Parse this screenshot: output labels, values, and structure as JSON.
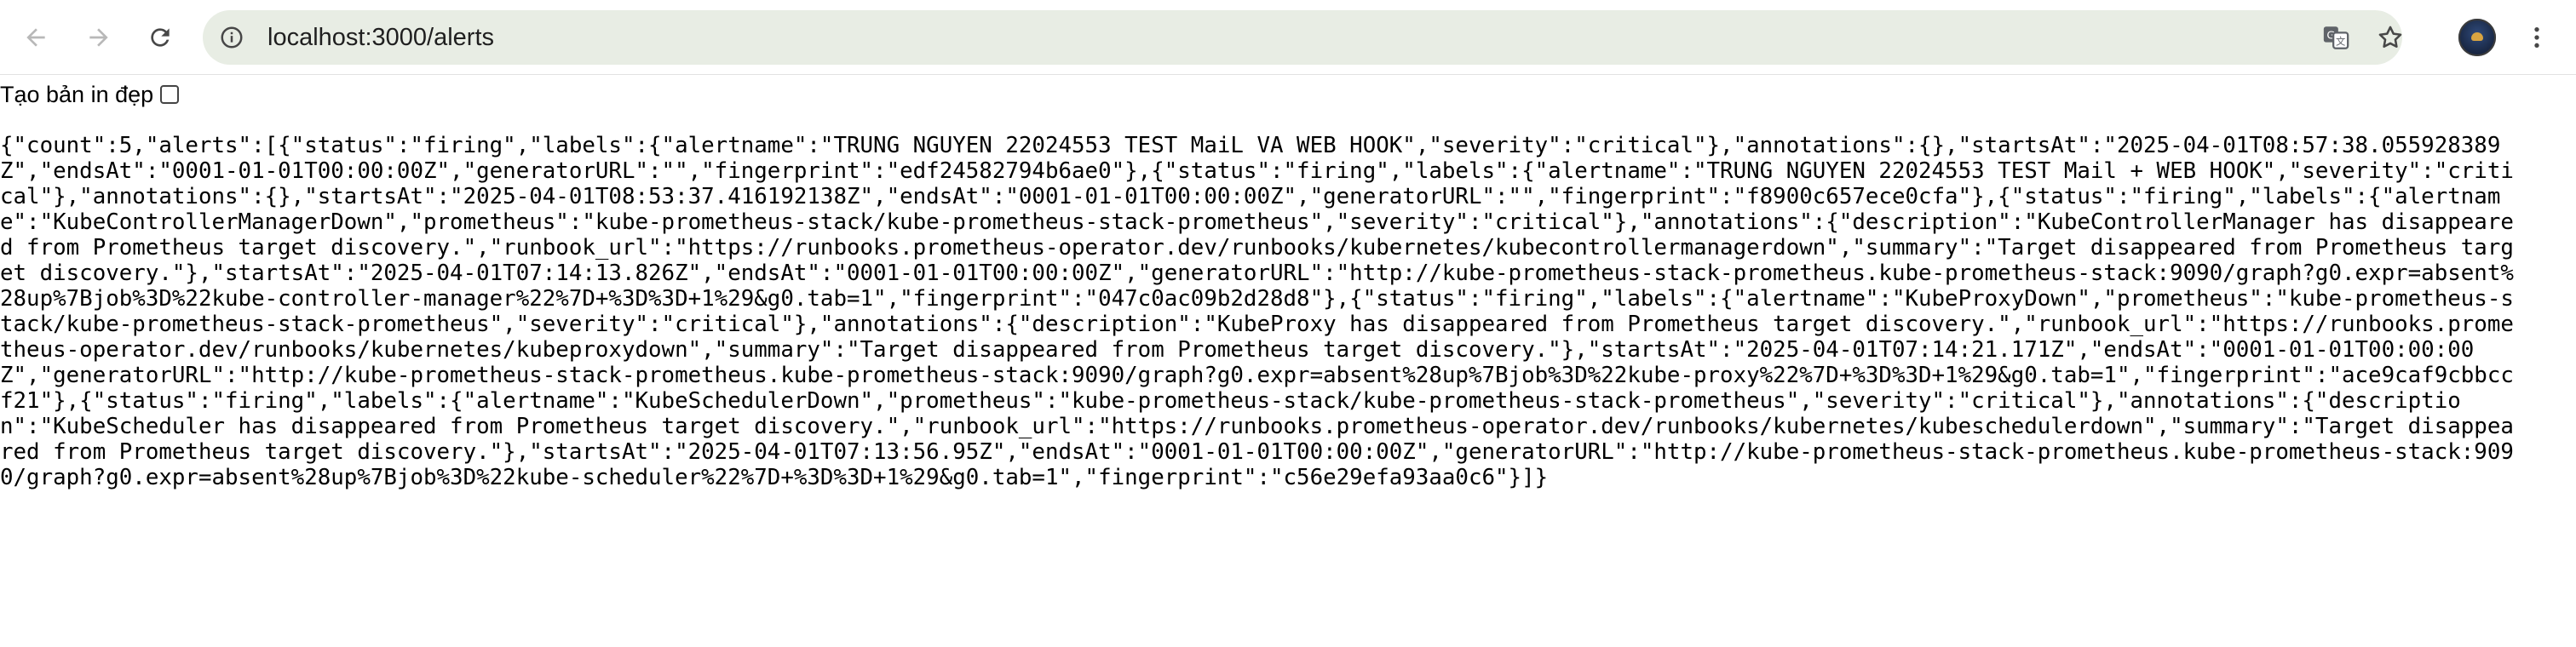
{
  "browser": {
    "url": "localhost:3000/alerts",
    "icons": [
      "back-arrow-icon",
      "forward-arrow-icon",
      "reload-icon",
      "site-info-icon",
      "translate-icon",
      "star-icon",
      "profile-avatar",
      "kebab-menu-icon"
    ]
  },
  "page": {
    "pretty_print_label": "Tạo bản in đẹp",
    "pretty_print_checked": false,
    "raw_json": "{\"count\":5,\"alerts\":[{\"status\":\"firing\",\"labels\":{\"alertname\":\"TRUNG NGUYEN 22024553 TEST MaiL VA WEB HOOK\",\"severity\":\"critical\"},\"annotations\":{},\"startsAt\":\"2025-04-01T08:57:38.055928389Z\",\"endsAt\":\"0001-01-01T00:00:00Z\",\"generatorURL\":\"\",\"fingerprint\":\"edf24582794b6ae0\"},{\"status\":\"firing\",\"labels\":{\"alertname\":\"TRUNG NGUYEN 22024553 TEST Mail + WEB HOOK\",\"severity\":\"critical\"},\"annotations\":{},\"startsAt\":\"2025-04-01T08:53:37.416192138Z\",\"endsAt\":\"0001-01-01T00:00:00Z\",\"generatorURL\":\"\",\"fingerprint\":\"f8900c657ece0cfa\"},{\"status\":\"firing\",\"labels\":{\"alertname\":\"KubeControllerManagerDown\",\"prometheus\":\"kube-prometheus-stack/kube-prometheus-stack-prometheus\",\"severity\":\"critical\"},\"annotations\":{\"description\":\"KubeControllerManager has disappeared from Prometheus target discovery.\",\"runbook_url\":\"https://runbooks.prometheus-operator.dev/runbooks/kubernetes/kubecontrollermanagerdown\",\"summary\":\"Target disappeared from Prometheus target discovery.\"},\"startsAt\":\"2025-04-01T07:14:13.826Z\",\"endsAt\":\"0001-01-01T00:00:00Z\",\"generatorURL\":\"http://kube-prometheus-stack-prometheus.kube-prometheus-stack:9090/graph?g0.expr=absent%28up%7Bjob%3D%22kube-controller-manager%22%7D+%3D%3D+1%29&g0.tab=1\",\"fingerprint\":\"047c0ac09b2d28d8\"},{\"status\":\"firing\",\"labels\":{\"alertname\":\"KubeProxyDown\",\"prometheus\":\"kube-prometheus-stack/kube-prometheus-stack-prometheus\",\"severity\":\"critical\"},\"annotations\":{\"description\":\"KubeProxy has disappeared from Prometheus target discovery.\",\"runbook_url\":\"https://runbooks.prometheus-operator.dev/runbooks/kubernetes/kubeproxydown\",\"summary\":\"Target disappeared from Prometheus target discovery.\"},\"startsAt\":\"2025-04-01T07:14:21.171Z\",\"endsAt\":\"0001-01-01T00:00:00Z\",\"generatorURL\":\"http://kube-prometheus-stack-prometheus.kube-prometheus-stack:9090/graph?g0.expr=absent%28up%7Bjob%3D%22kube-proxy%22%7D+%3D%3D+1%29&g0.tab=1\",\"fingerprint\":\"ace9caf9cbbccf21\"},{\"status\":\"firing\",\"labels\":{\"alertname\":\"KubeSchedulerDown\",\"prometheus\":\"kube-prometheus-stack/kube-prometheus-stack-prometheus\",\"severity\":\"critical\"},\"annotations\":{\"description\":\"KubeScheduler has disappeared from Prometheus target discovery.\",\"runbook_url\":\"https://runbooks.prometheus-operator.dev/runbooks/kubernetes/kubeschedulerdown\",\"summary\":\"Target disappeared from Prometheus target discovery.\"},\"startsAt\":\"2025-04-01T07:13:56.95Z\",\"endsAt\":\"0001-01-01T00:00:00Z\",\"generatorURL\":\"http://kube-prometheus-stack-prometheus.kube-prometheus-stack:9090/graph?g0.expr=absent%28up%7Bjob%3D%22kube-scheduler%22%7D+%3D%3D+1%29&g0.tab=1\",\"fingerprint\":\"c56e29efa93aa0c6\"}]}"
  }
}
